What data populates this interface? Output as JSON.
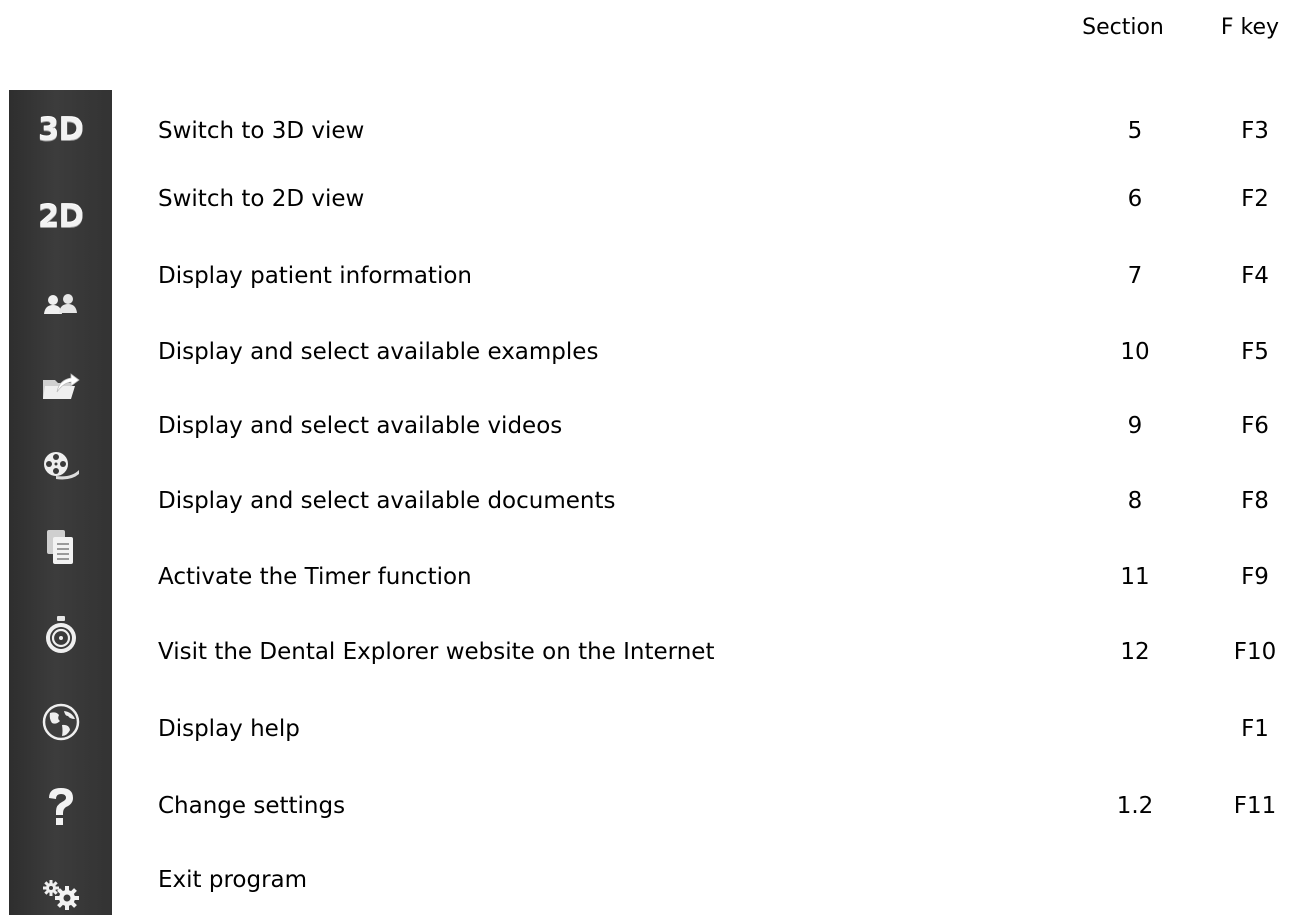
{
  "header": {
    "section_label": "Section",
    "fkey_label": "F key"
  },
  "rows": [
    {
      "icon": "3d-view-icon",
      "icon_text": "3D",
      "label": "Switch to 3D view",
      "section": "5",
      "fkey": "F3"
    },
    {
      "icon": "2d-view-icon",
      "icon_text": "2D",
      "label": "Switch to 2D view",
      "section": "6",
      "fkey": "F2"
    },
    {
      "icon": "patients-icon",
      "label": "Display patient information",
      "section": "7",
      "fkey": "F4"
    },
    {
      "icon": "folder-open-icon",
      "label": "Display and select available examples",
      "section": "10",
      "fkey": "F5"
    },
    {
      "icon": "film-reel-icon",
      "label": "Display and select available videos",
      "section": "9",
      "fkey": "F6"
    },
    {
      "icon": "documents-icon",
      "label": "Display and select available documents",
      "section": "8",
      "fkey": "F8"
    },
    {
      "icon": "stopwatch-icon",
      "label": "Activate the Timer function",
      "section": "11",
      "fkey": "F9"
    },
    {
      "icon": "globe-icon",
      "label": "Visit the Dental Explorer website on the Internet",
      "section": "12",
      "fkey": "F10"
    },
    {
      "icon": "help-question-icon",
      "label": "Display help",
      "section": "",
      "fkey": "F1"
    },
    {
      "icon": "help-question-icon",
      "label": "Change settings",
      "section": "1.2",
      "fkey": "F11"
    },
    {
      "icon": "settings-gears-icon",
      "label": "Exit program",
      "section": "",
      "fkey": ""
    }
  ],
  "colors": {
    "toolbar_bg": "#333333",
    "icon_fg": "#f2f2f2"
  }
}
